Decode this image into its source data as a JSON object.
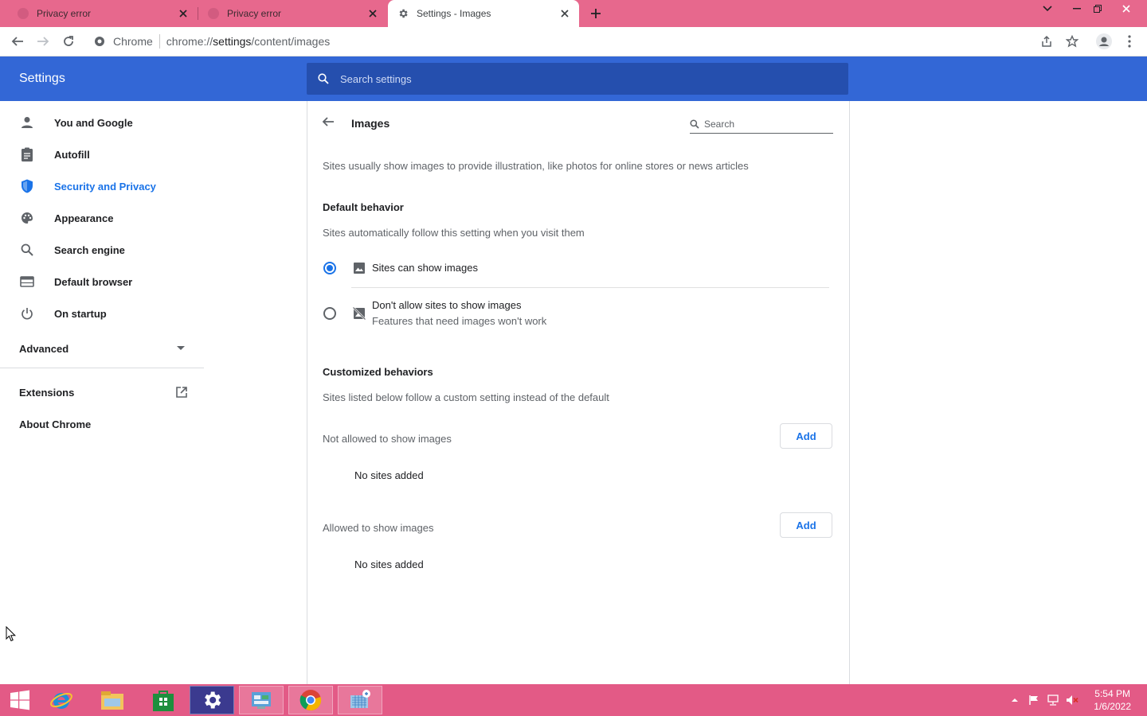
{
  "browser": {
    "tabs": [
      {
        "title": "Privacy error",
        "active": false
      },
      {
        "title": "Privacy error",
        "active": false
      },
      {
        "title": "Settings - Images",
        "active": true
      }
    ],
    "omnibox": {
      "site": "Chrome",
      "url_prefix": "chrome://",
      "url_host": "settings",
      "url_path": "/content/images"
    }
  },
  "settings": {
    "title": "Settings",
    "search_placeholder": "Search settings",
    "nav": [
      {
        "label": "You and Google",
        "icon": "person-icon",
        "selected": false
      },
      {
        "label": "Autofill",
        "icon": "clipboard-icon",
        "selected": false
      },
      {
        "label": "Security and Privacy",
        "icon": "shield-icon",
        "selected": true
      },
      {
        "label": "Appearance",
        "icon": "palette-icon",
        "selected": false
      },
      {
        "label": "Search engine",
        "icon": "search-icon",
        "selected": false
      },
      {
        "label": "Default browser",
        "icon": "browser-icon",
        "selected": false
      },
      {
        "label": "On startup",
        "icon": "power-icon",
        "selected": false
      }
    ],
    "advanced": "Advanced",
    "extensions": "Extensions",
    "about": "About Chrome"
  },
  "page": {
    "title": "Images",
    "search_placeholder": "Search",
    "description": "Sites usually show images to provide illustration, like photos for online stores or news articles",
    "default_behavior": {
      "heading": "Default behavior",
      "subtext": "Sites automatically follow this setting when you visit them",
      "options": [
        {
          "label": "Sites can show images",
          "sublabel": "",
          "selected": true
        },
        {
          "label": "Don't allow sites to show images",
          "sublabel": "Features that need images won't work",
          "selected": false
        }
      ]
    },
    "customized": {
      "heading": "Customized behaviors",
      "subtext": "Sites listed below follow a custom setting instead of the default",
      "lists": [
        {
          "label": "Not allowed to show images",
          "button": "Add",
          "empty": "No sites added"
        },
        {
          "label": "Allowed to show images",
          "button": "Add",
          "empty": "No sites added"
        }
      ]
    }
  },
  "taskbar": {
    "time": "5:54 PM",
    "date": "1/6/2022"
  },
  "colors": {
    "tabstrip": "#e7688d",
    "settings_header": "#3367d6",
    "accent": "#1a73e8",
    "taskbar": "#e35a86"
  }
}
